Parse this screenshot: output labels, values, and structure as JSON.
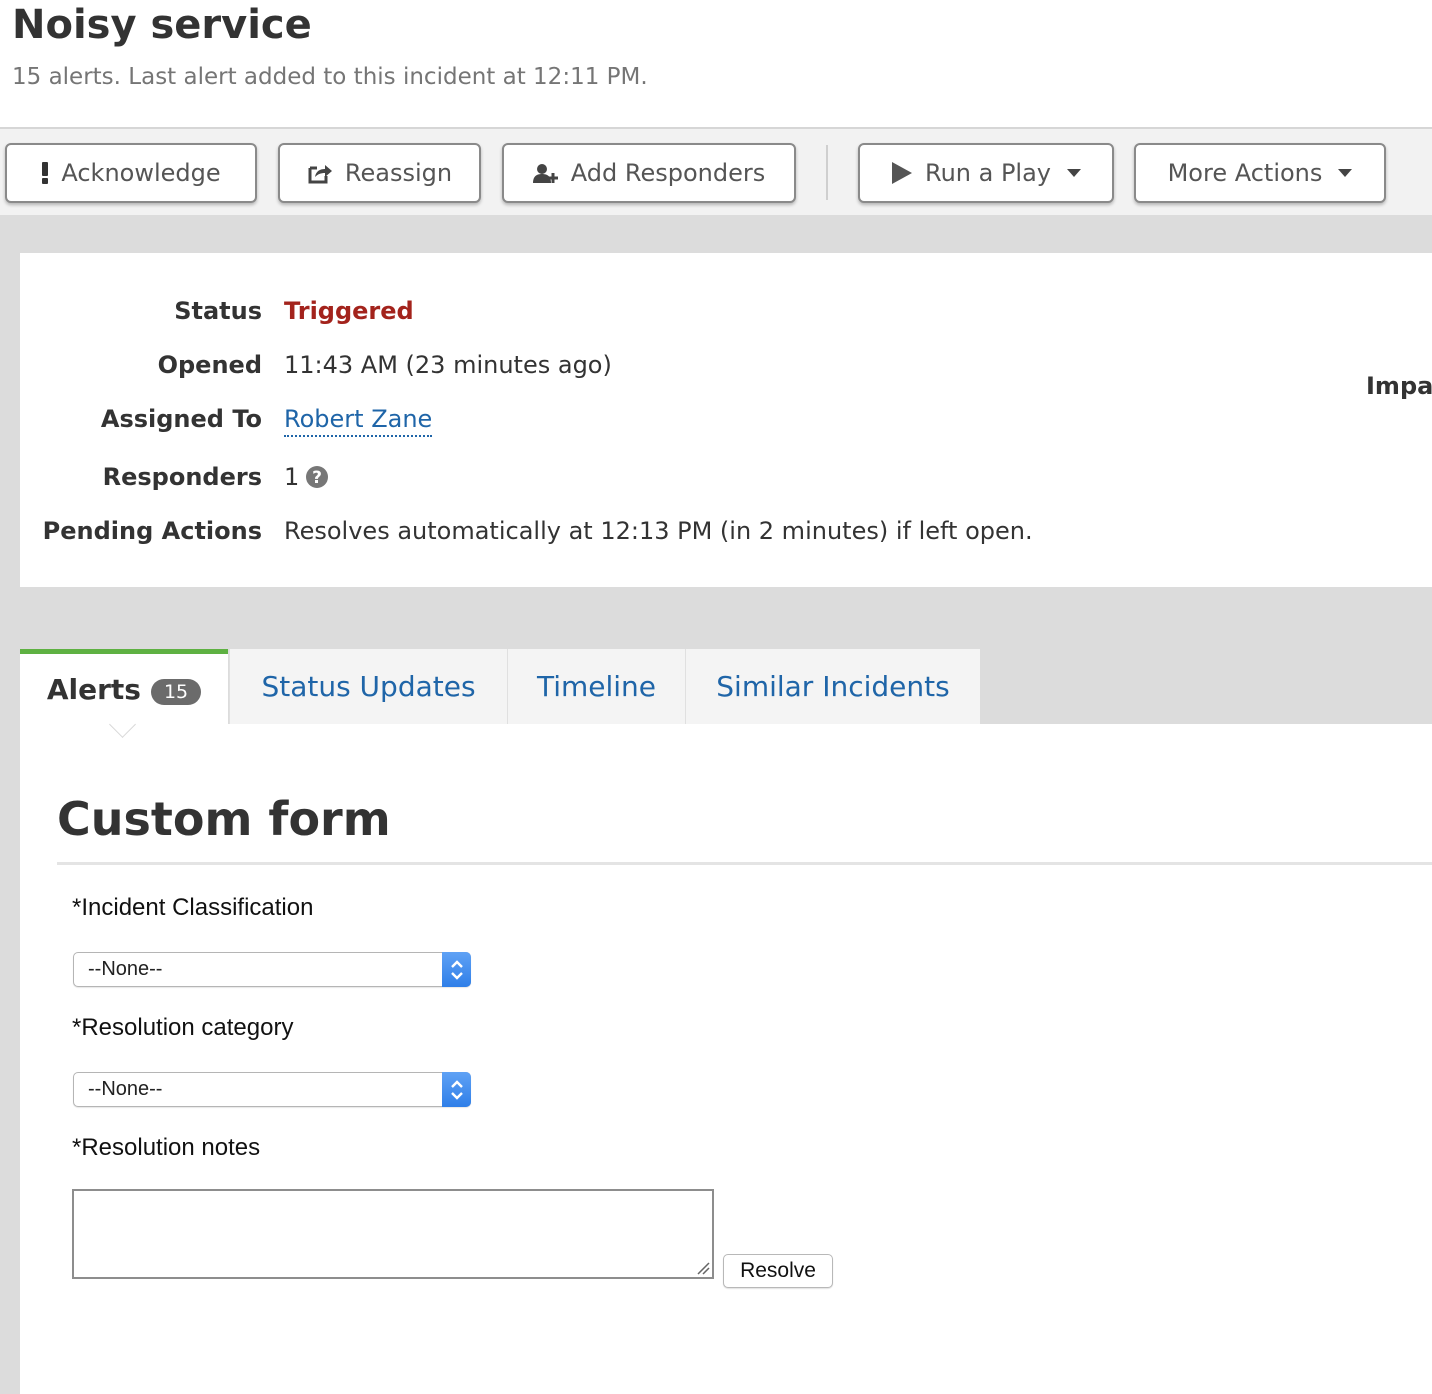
{
  "header": {
    "title": "Noisy service",
    "subtitle": "15 alerts. Last alert added to this incident at 12:11 PM."
  },
  "toolbar": {
    "acknowledge_label": "Acknowledge",
    "reassign_label": "Reassign",
    "add_responders_label": "Add Responders",
    "run_play_label": "Run a Play",
    "more_actions_label": "More Actions"
  },
  "details": {
    "status_label": "Status",
    "status_value": "Triggered",
    "opened_label": "Opened",
    "opened_value": "11:43 AM (23 minutes ago)",
    "assigned_label": "Assigned To",
    "assigned_value": "Robert Zane",
    "responders_label": "Responders",
    "responders_value": "1",
    "pending_label": "Pending Actions",
    "pending_value": "Resolves automatically at 12:13 PM (in 2 minutes) if left open.",
    "impact_label": "Impa"
  },
  "tabs": [
    {
      "label": "Alerts",
      "badge": "15"
    },
    {
      "label": "Status Updates"
    },
    {
      "label": "Timeline"
    },
    {
      "label": "Similar Incidents"
    }
  ],
  "form": {
    "title": "Custom form",
    "classification_label": "*Incident Classification",
    "classification_value": "--None--",
    "category_label": "*Resolution category",
    "category_value": "--None--",
    "notes_label": "*Resolution notes",
    "notes_value": "",
    "resolve_label": "Resolve"
  },
  "colors": {
    "status_triggered": "#a3231c",
    "link": "#1f65a8",
    "active_tab_accent": "#5eb142"
  }
}
